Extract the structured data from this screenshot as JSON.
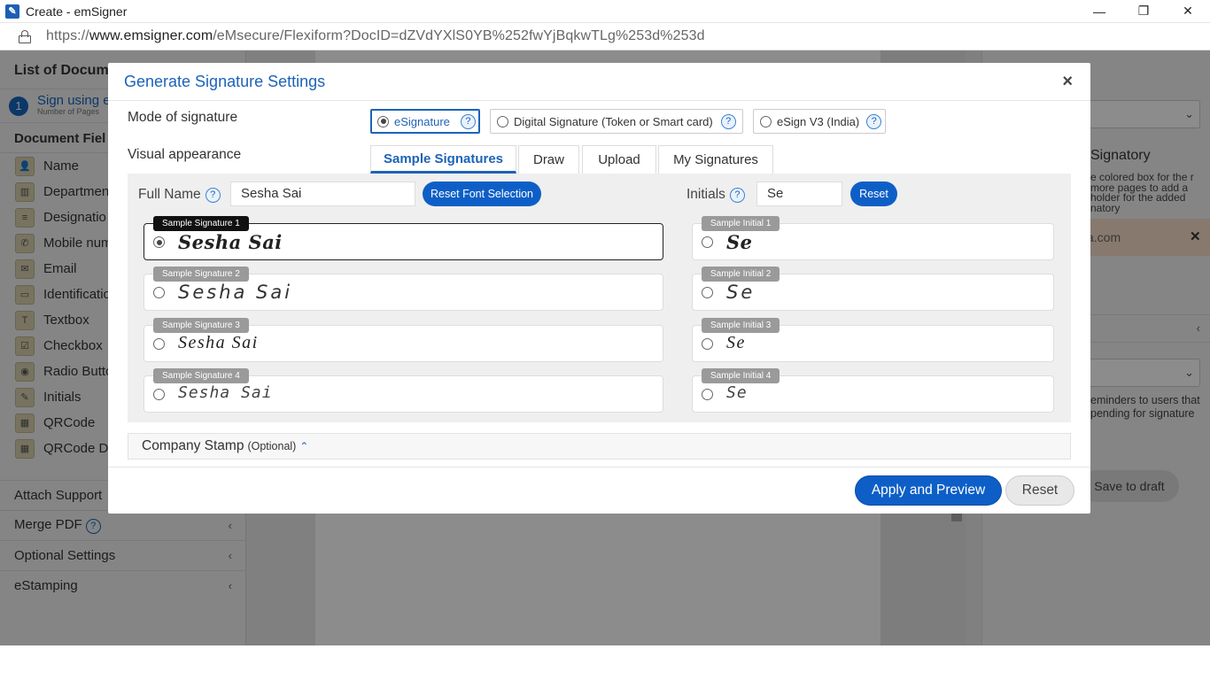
{
  "window": {
    "title": "Create - emSigner",
    "app_icon": "emsigner-icon",
    "controls": {
      "minimize": "—",
      "restore": "❐",
      "close": "✕"
    }
  },
  "address_bar": {
    "url_prefix": "https://",
    "url_domain": "www.emsigner.com",
    "url_path": "/eMsecure/Flexiform?DocID=dZVdYXlS0YB%252fwYjBqkwTLg%253d%253d"
  },
  "left_panel": {
    "header": "List of Documen",
    "step": {
      "number": "1",
      "label": "Sign using em",
      "sublabel": "Number of Pages"
    },
    "fields_header": "Document Fiel",
    "fields": [
      {
        "label": "Name",
        "icon": "user-icon",
        "glyph": "👤"
      },
      {
        "label": "Departmen",
        "icon": "building-icon",
        "glyph": "▥"
      },
      {
        "label": "Designatio",
        "icon": "badge-icon",
        "glyph": "≡"
      },
      {
        "label": "Mobile num",
        "icon": "phone-icon",
        "glyph": "✆"
      },
      {
        "label": "Email",
        "icon": "envelope-icon",
        "glyph": "✉"
      },
      {
        "label": "Identificatio",
        "icon": "id-card-icon",
        "glyph": "▭"
      },
      {
        "label": "Textbox",
        "icon": "text-icon",
        "glyph": "T"
      },
      {
        "label": "Checkbox",
        "icon": "checkbox-icon",
        "glyph": "☑"
      },
      {
        "label": "Radio Butto",
        "icon": "radio-icon",
        "glyph": "◉"
      },
      {
        "label": "Initials",
        "icon": "pen-icon",
        "glyph": "✎"
      },
      {
        "label": "QRCode",
        "icon": "qrcode-icon",
        "glyph": "▦"
      },
      {
        "label": "QRCode Di",
        "icon": "qrcode-icon",
        "glyph": "▦"
      }
    ],
    "attach": "Attach Support",
    "merge_pdf": "Merge PDF",
    "optional_settings": "Optional Settings",
    "estamping": "eStamping"
  },
  "right_panel": {
    "signatory_title": "Signatory",
    "help_text": "e colored box for the r more pages to add a holder for the added natory",
    "email_suffix": "a.com",
    "remind_text": "eminders to users that pending for signature",
    "save_draft": "Save to draft"
  },
  "modal": {
    "title": "Generate Signature Settings",
    "close": "×",
    "mode_label": "Mode of signature",
    "modes": [
      {
        "label": "eSignature",
        "selected": true
      },
      {
        "label": "Digital Signature (Token or Smart card)",
        "selected": false
      },
      {
        "label": "eSign V3 (India)",
        "selected": false
      }
    ],
    "visual_label": "Visual appearance",
    "tabs": [
      {
        "label": "Sample Signatures",
        "active": true
      },
      {
        "label": "Draw",
        "active": false
      },
      {
        "label": "Upload",
        "active": false
      },
      {
        "label": "My Signatures",
        "active": false
      }
    ],
    "full_name_label": "Full Name",
    "full_name_value": "Sesha Sai",
    "reset_font_button": "Reset Font Selection",
    "initials_label": "Initials",
    "initials_value": "Se",
    "reset_initials_button": "Reset",
    "help_glyph": "?",
    "signatures": [
      {
        "tag": "Sample Signature 1",
        "text": "Sesha Sai",
        "selected": true
      },
      {
        "tag": "Sample Signature 2",
        "text": "Sesha Sai",
        "selected": false
      },
      {
        "tag": "Sample Signature 3",
        "text": "Sesha Sai",
        "selected": false
      },
      {
        "tag": "Sample Signature 4",
        "text": "Sesha Sai",
        "selected": false
      }
    ],
    "initials": [
      {
        "tag": "Sample Initial 1",
        "text": "Se",
        "selected": false
      },
      {
        "tag": "Sample Initial 2",
        "text": "Se",
        "selected": false
      },
      {
        "tag": "Sample Initial 3",
        "text": "Se",
        "selected": false
      },
      {
        "tag": "Sample Initial 4",
        "text": "Se",
        "selected": false
      }
    ],
    "company_stamp": "Company Stamp",
    "company_stamp_optional": "(Optional)",
    "apply_button": "Apply and Preview",
    "reset_button": "Reset",
    "accent_color": "#0d5fc7"
  }
}
